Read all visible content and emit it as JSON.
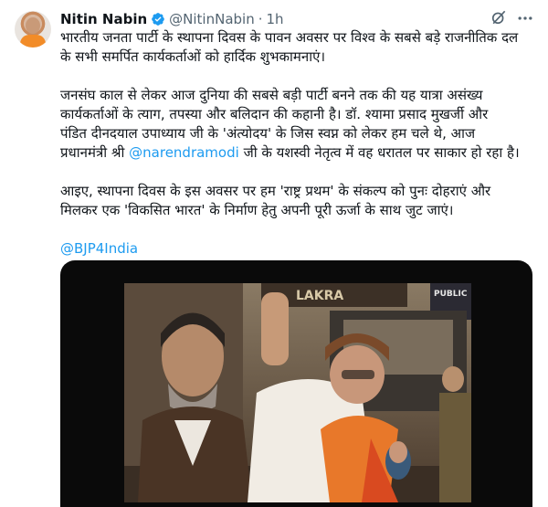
{
  "author": {
    "name": "Nitin Nabin",
    "handle": "@NitinNabin",
    "time": "1h",
    "separator": "·"
  },
  "tweet": {
    "p1": "भारतीय जनता पार्टी के स्थापना दिवस के पावन अवसर पर विश्व के सबसे बड़े राजनीतिक दल\nके सभी समर्पित कार्यकर्ताओं को हार्दिक शुभकामनाएं।",
    "p2_a": "जनसंघ काल से लेकर आज दुनिया की सबसे बड़ी पार्टी बनने तक की यह यात्रा असंख्य\nकार्यकर्ताओं के त्याग, तपस्या और बलिदान की कहानी है। डॉ. श्यामा प्रसाद मुखर्जी और\nपंडित दीनदयाल उपाध्याय जी के 'अंत्योदय' के जिस स्वप्न को लेकर हम चले थे, आज\nप्रधानमंत्री श्री ",
    "p2_mention": "@narendramodi",
    "p2_b": " जी के यशस्वी नेतृत्व में वह धरातल पर साकार हो रहा है।",
    "p3": "आइए, स्थापना दिवस के इस अवसर पर हम 'राष्ट्र प्रथम' के संकल्प को पुनः दोहराएं और\nमिलकर एक 'विकसित भारत' के निर्माण हेतु अपनी पूरी ऊर्जा के साथ जुट जाएं।",
    "mention_bjp": "@BJP4India"
  },
  "media": {
    "sign_text": "LAKRA",
    "sign_text_2": "PUBLIC"
  },
  "colors": {
    "accent": "#1d9bf0",
    "secondary_text": "#536471"
  },
  "icons": {
    "verified": "verified-badge-icon",
    "grok": "grok-icon",
    "more": "more-icon"
  }
}
